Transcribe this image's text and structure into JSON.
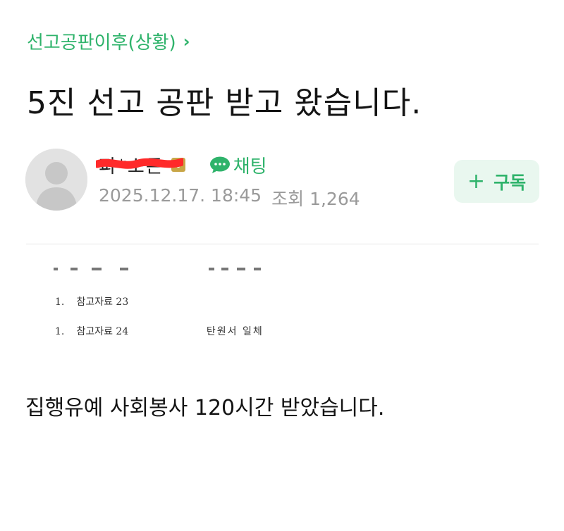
{
  "category": {
    "label": "선고공판이후(상황)",
    "chevron": "›"
  },
  "post": {
    "title": "5진 선고 공판 받고 왔습니다.",
    "body": "집행유예 사회봉사 120시간 받았습니다."
  },
  "author": {
    "name": "피*소돈",
    "verified_badge": "V",
    "chat_label": "채팅",
    "date": "2025.12.17. 18:45",
    "views_label": "조회",
    "views": "1,264"
  },
  "subscribe": {
    "plus": "+",
    "label": "구독"
  },
  "document": {
    "items": [
      {
        "num": "1.",
        "label": "참고자료 23",
        "note": ""
      },
      {
        "num": "1.",
        "label": "참고자료 24",
        "note": "탄원서 일체"
      }
    ]
  },
  "colors": {
    "accent": "#2fb36b",
    "subscribe_bg": "#e9f7ef",
    "badge": "#c8a647",
    "redaction": "#ff2a2a",
    "meta_text": "#9a9a9a"
  },
  "icons": {
    "avatar": "default-avatar-icon",
    "chat": "chat-bubble-icon",
    "chevron": "chevron-right-icon",
    "verified": "verified-badge-icon",
    "plus": "plus-icon"
  }
}
